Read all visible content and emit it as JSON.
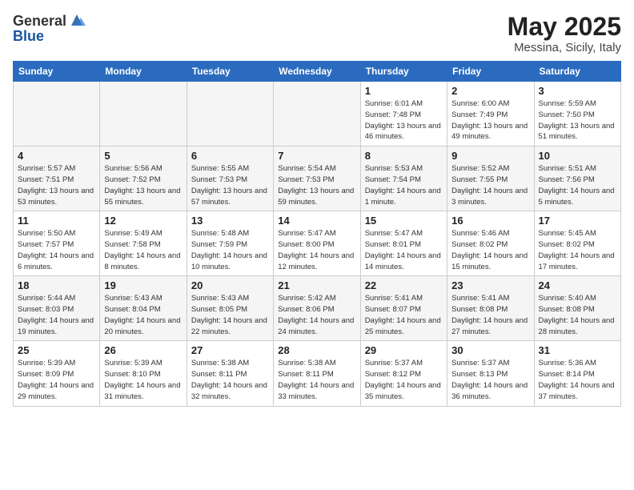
{
  "header": {
    "logo_general": "General",
    "logo_blue": "Blue",
    "title": "May 2025",
    "subtitle": "Messina, Sicily, Italy"
  },
  "days_of_week": [
    "Sunday",
    "Monday",
    "Tuesday",
    "Wednesday",
    "Thursday",
    "Friday",
    "Saturday"
  ],
  "weeks": [
    [
      {
        "day": "",
        "empty": true
      },
      {
        "day": "",
        "empty": true
      },
      {
        "day": "",
        "empty": true
      },
      {
        "day": "",
        "empty": true
      },
      {
        "day": "1",
        "sunrise": "6:01 AM",
        "sunset": "7:48 PM",
        "daylight": "13 hours and 46 minutes."
      },
      {
        "day": "2",
        "sunrise": "6:00 AM",
        "sunset": "7:49 PM",
        "daylight": "13 hours and 49 minutes."
      },
      {
        "day": "3",
        "sunrise": "5:59 AM",
        "sunset": "7:50 PM",
        "daylight": "13 hours and 51 minutes."
      }
    ],
    [
      {
        "day": "4",
        "sunrise": "5:57 AM",
        "sunset": "7:51 PM",
        "daylight": "13 hours and 53 minutes."
      },
      {
        "day": "5",
        "sunrise": "5:56 AM",
        "sunset": "7:52 PM",
        "daylight": "13 hours and 55 minutes."
      },
      {
        "day": "6",
        "sunrise": "5:55 AM",
        "sunset": "7:53 PM",
        "daylight": "13 hours and 57 minutes."
      },
      {
        "day": "7",
        "sunrise": "5:54 AM",
        "sunset": "7:53 PM",
        "daylight": "13 hours and 59 minutes."
      },
      {
        "day": "8",
        "sunrise": "5:53 AM",
        "sunset": "7:54 PM",
        "daylight": "14 hours and 1 minute."
      },
      {
        "day": "9",
        "sunrise": "5:52 AM",
        "sunset": "7:55 PM",
        "daylight": "14 hours and 3 minutes."
      },
      {
        "day": "10",
        "sunrise": "5:51 AM",
        "sunset": "7:56 PM",
        "daylight": "14 hours and 5 minutes."
      }
    ],
    [
      {
        "day": "11",
        "sunrise": "5:50 AM",
        "sunset": "7:57 PM",
        "daylight": "14 hours and 6 minutes."
      },
      {
        "day": "12",
        "sunrise": "5:49 AM",
        "sunset": "7:58 PM",
        "daylight": "14 hours and 8 minutes."
      },
      {
        "day": "13",
        "sunrise": "5:48 AM",
        "sunset": "7:59 PM",
        "daylight": "14 hours and 10 minutes."
      },
      {
        "day": "14",
        "sunrise": "5:47 AM",
        "sunset": "8:00 PM",
        "daylight": "14 hours and 12 minutes."
      },
      {
        "day": "15",
        "sunrise": "5:47 AM",
        "sunset": "8:01 PM",
        "daylight": "14 hours and 14 minutes."
      },
      {
        "day": "16",
        "sunrise": "5:46 AM",
        "sunset": "8:02 PM",
        "daylight": "14 hours and 15 minutes."
      },
      {
        "day": "17",
        "sunrise": "5:45 AM",
        "sunset": "8:02 PM",
        "daylight": "14 hours and 17 minutes."
      }
    ],
    [
      {
        "day": "18",
        "sunrise": "5:44 AM",
        "sunset": "8:03 PM",
        "daylight": "14 hours and 19 minutes."
      },
      {
        "day": "19",
        "sunrise": "5:43 AM",
        "sunset": "8:04 PM",
        "daylight": "14 hours and 20 minutes."
      },
      {
        "day": "20",
        "sunrise": "5:43 AM",
        "sunset": "8:05 PM",
        "daylight": "14 hours and 22 minutes."
      },
      {
        "day": "21",
        "sunrise": "5:42 AM",
        "sunset": "8:06 PM",
        "daylight": "14 hours and 24 minutes."
      },
      {
        "day": "22",
        "sunrise": "5:41 AM",
        "sunset": "8:07 PM",
        "daylight": "14 hours and 25 minutes."
      },
      {
        "day": "23",
        "sunrise": "5:41 AM",
        "sunset": "8:08 PM",
        "daylight": "14 hours and 27 minutes."
      },
      {
        "day": "24",
        "sunrise": "5:40 AM",
        "sunset": "8:08 PM",
        "daylight": "14 hours and 28 minutes."
      }
    ],
    [
      {
        "day": "25",
        "sunrise": "5:39 AM",
        "sunset": "8:09 PM",
        "daylight": "14 hours and 29 minutes."
      },
      {
        "day": "26",
        "sunrise": "5:39 AM",
        "sunset": "8:10 PM",
        "daylight": "14 hours and 31 minutes."
      },
      {
        "day": "27",
        "sunrise": "5:38 AM",
        "sunset": "8:11 PM",
        "daylight": "14 hours and 32 minutes."
      },
      {
        "day": "28",
        "sunrise": "5:38 AM",
        "sunset": "8:11 PM",
        "daylight": "14 hours and 33 minutes."
      },
      {
        "day": "29",
        "sunrise": "5:37 AM",
        "sunset": "8:12 PM",
        "daylight": "14 hours and 35 minutes."
      },
      {
        "day": "30",
        "sunrise": "5:37 AM",
        "sunset": "8:13 PM",
        "daylight": "14 hours and 36 minutes."
      },
      {
        "day": "31",
        "sunrise": "5:36 AM",
        "sunset": "8:14 PM",
        "daylight": "14 hours and 37 minutes."
      }
    ]
  ],
  "labels": {
    "sunrise": "Sunrise:",
    "sunset": "Sunset:",
    "daylight": "Daylight:"
  }
}
